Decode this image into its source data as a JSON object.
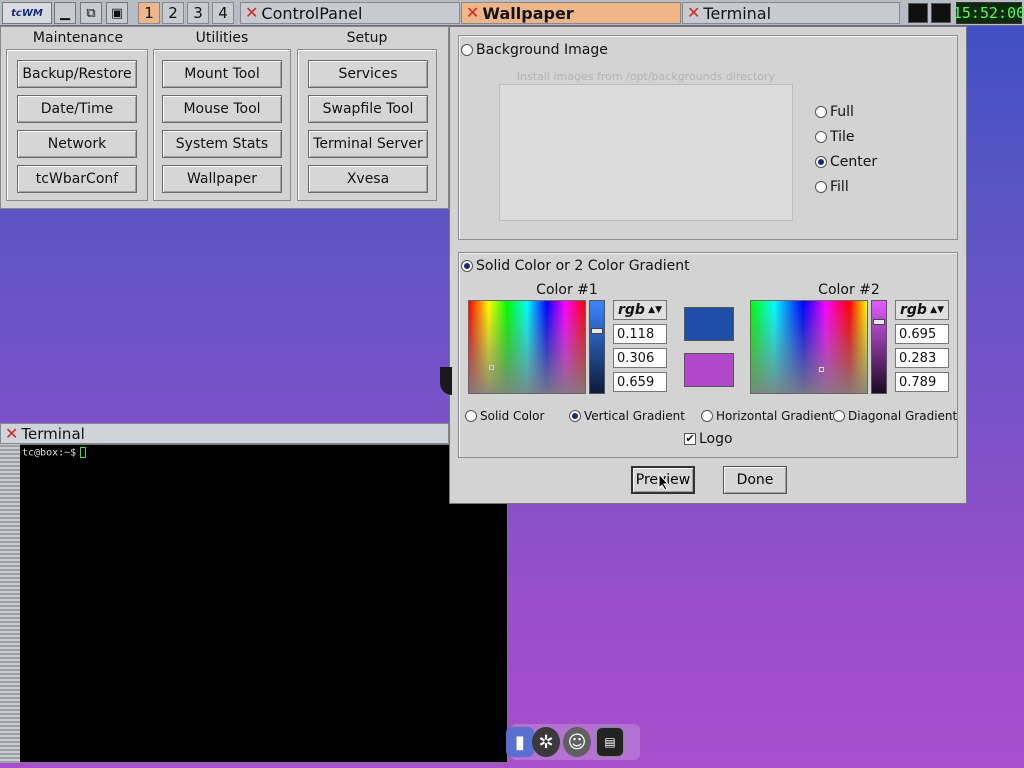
{
  "taskbar": {
    "logo": "tcWM",
    "workspaces": [
      "1",
      "2",
      "3",
      "4"
    ],
    "tasks": [
      {
        "label": "ControlPanel"
      },
      {
        "label": "Wallpaper"
      },
      {
        "label": "Terminal"
      }
    ],
    "clock": "15:52:00"
  },
  "control_panel": {
    "columns": [
      {
        "heading": "Maintenance",
        "buttons": [
          "Backup/Restore",
          "Date/Time",
          "Network",
          "tcWbarConf"
        ]
      },
      {
        "heading": "Utilities",
        "buttons": [
          "Mount Tool",
          "Mouse Tool",
          "System Stats",
          "Wallpaper"
        ]
      },
      {
        "heading": "Setup",
        "buttons": [
          "Services",
          "Swapfile Tool",
          "Terminal Server",
          "Xvesa"
        ]
      }
    ]
  },
  "wallpaper": {
    "background_image_label": "Background Image",
    "install_hint": "Install images from /opt/backgrounds directory",
    "placement_options": [
      "Full",
      "Tile",
      "Center",
      "Fill"
    ],
    "placement_selected": "Center",
    "solid_label": "Solid Color or 2 Color Gradient",
    "color1": {
      "title": "Color #1",
      "mode": "rgb",
      "r": "0.118",
      "g": "0.306",
      "b": "0.659",
      "swatch": "#1e4ea8",
      "slider_level": 0.69
    },
    "color2": {
      "title": "Color #2",
      "mode": "rgb",
      "r": "0.695",
      "g": "0.283",
      "b": "0.789",
      "swatch": "#b148c9",
      "slider_level": 0.79
    },
    "gradient_options": [
      "Solid Color",
      "Vertical Gradient",
      "Horizontal Gradient",
      "Diagonal Gradient"
    ],
    "gradient_selected": "Vertical Gradient",
    "logo_label": "Logo",
    "logo_checked": true,
    "preview_label": "Preview",
    "done_label": "Done"
  },
  "terminal": {
    "title": "Terminal",
    "prompt": "tc@box:~$"
  }
}
